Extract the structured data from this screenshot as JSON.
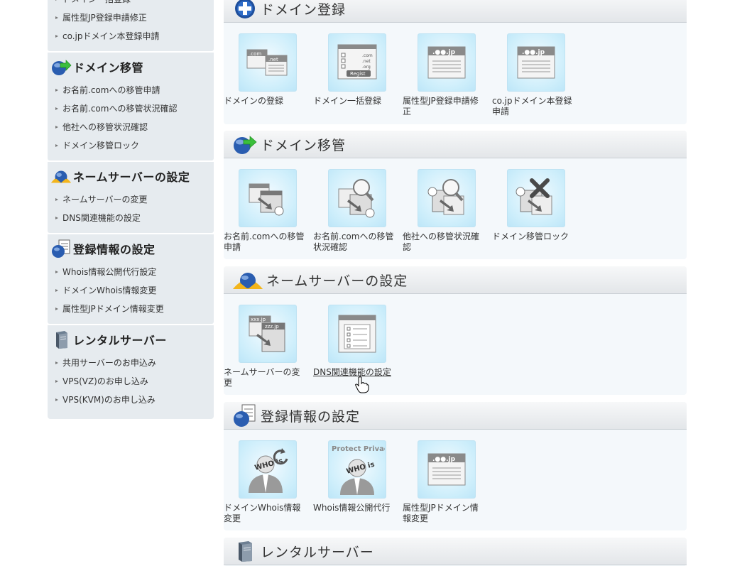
{
  "sidebar": {
    "top_partial": "ドメイン一括登録",
    "first_items": [
      "属性型JP登録申請修正",
      "co.jpドメイン本登録申請"
    ],
    "blocks": [
      {
        "title": "ドメイン移管",
        "items": [
          "お名前.comへの移管申請",
          "お名前.comへの移管状況確認",
          "他社への移管状況確認",
          "ドメイン移管ロック"
        ]
      },
      {
        "title": "ネームサーバーの設定",
        "items": [
          "ネームサーバーの変更",
          "DNS関連機能の設定"
        ]
      },
      {
        "title": "登録情報の設定",
        "items": [
          "Whois情報公開代行設定",
          "ドメインWhois情報変更",
          "属性型JPドメイン情報変更"
        ]
      },
      {
        "title": "レンタルサーバー",
        "items": [
          "共用サーバーのお申込み",
          "VPS(VZ)のお申し込み",
          "VPS(KVM)のお申し込み"
        ]
      }
    ]
  },
  "sections": [
    {
      "title": "ドメイン登録",
      "tiles": [
        {
          "label": "ドメインの登録",
          "icon": "com-net-windows-icon",
          "icon_text": [
            ".com",
            ".net"
          ]
        },
        {
          "label": "ドメイン一括登録",
          "icon": "bulk-register-form-icon",
          "icon_text": [
            ".com",
            ".net",
            ".org",
            "Regist"
          ]
        },
        {
          "label": "属性型JP登録申請修正",
          "icon": "jp-window-icon",
          "icon_text": [
            ".●●.jp"
          ]
        },
        {
          "label": "co.jpドメイン本登録申請",
          "icon": "jp-window-icon",
          "icon_text": [
            ".●●.jp"
          ]
        }
      ]
    },
    {
      "title": "ドメイン移管",
      "tiles": [
        {
          "label": "お名前.comへの移管申請",
          "icon": "transfer-boxes-icon"
        },
        {
          "label": "お名前.comへの移管状況確認",
          "icon": "transfer-search-icon"
        },
        {
          "label": "他社への移管状況確認",
          "icon": "transfer-search-icon"
        },
        {
          "label": "ドメイン移管ロック",
          "icon": "transfer-lock-icon"
        }
      ]
    },
    {
      "title": "ネームサーバーの設定",
      "tiles": [
        {
          "label": "ネームサーバーの変更",
          "icon": "nameserver-change-icon",
          "icon_text": [
            "xxx.jp",
            "zzz.jp"
          ]
        },
        {
          "label": "DNS関連機能の設定",
          "icon": "dns-settings-form-icon"
        }
      ]
    },
    {
      "title": "登録情報の設定",
      "tiles": [
        {
          "label": "ドメインWhois情報変更",
          "icon": "whois-refresh-person-icon",
          "icon_text": [
            "WHO is"
          ]
        },
        {
          "label": "Whois情報公開代行",
          "icon": "whois-privacy-person-icon",
          "icon_text": [
            "Protect Privacy",
            "WHO is"
          ]
        },
        {
          "label": "属性型JPドメイン情報変更",
          "icon": "jp-window-icon",
          "icon_text": [
            ".●●.jp"
          ]
        }
      ]
    },
    {
      "title": "レンタルサーバー",
      "tiles": []
    }
  ],
  "colors": {
    "sidebar_bg": "#e6ebef",
    "section_bg": "#f4f8fb",
    "tile_glow": "#cdeefb"
  }
}
